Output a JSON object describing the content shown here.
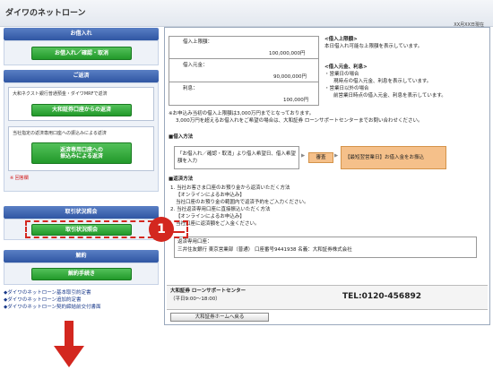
{
  "header": {
    "title": "ダイワのネットローン",
    "date": "XX月XX日現在"
  },
  "left": {
    "borrow": {
      "title": "お借入れ",
      "btn": "お借入れ／確認・取消"
    },
    "repay": {
      "title": "ご返済",
      "box1_title": "大和ネクスト銀行普通預金・ダイワMRFで返済",
      "box1_btn": "大和証券口座からの返済",
      "box2_title": "当社指定の返済専用口座への振込みによる返済",
      "box2_btn_line1": "返済専用口座への",
      "box2_btn_line2": "振込みによる返済",
      "note": "※ 回答欄"
    },
    "history": {
      "title": "取引状況照会",
      "btn": "取引状況照会"
    },
    "cancel": {
      "title": "解約",
      "btn": "解約手続き"
    },
    "links": [
      "◆ダイワのネットローン基本取引約定書",
      "◆ダイワのネットローン追加約定書",
      "◆ダイワのネットローン契約締結前交付書面"
    ]
  },
  "right": {
    "limit": {
      "label": "借入上限額：",
      "value": "100,000,000円"
    },
    "balance": {
      "label": "借入元金：",
      "value": "90,000,000円"
    },
    "interest": {
      "label": "利息：",
      "value": "100,000円"
    },
    "limit_note_title": "<借入上限額>",
    "limit_note": "本日借入れ可能な上限額を表示しています。",
    "principal_note_title": "<借入元金、利息>",
    "principal_note_1": "・営業日の場合",
    "principal_note_2": "現時点の借入元金、利息を表示しています。",
    "principal_note_3": "・営業日以外の場合",
    "principal_note_4": "前営業日時点の借入元金、利息を表示しています。",
    "warn_1": "※お申込み当初の借入上限額は3,000万円までとなっております。",
    "warn_2": "3,000万円を超えるお借入れをご希望の場合は、大和証券 ローンサポートセンターまでお問い合わせください。",
    "method_title": "■借入方法",
    "method_step1": "「お借入れ／確認・取消」より借入希望日、借入希望額を入力",
    "method_step2": "審査",
    "method_step3": "【最短翌営業日】お借入金をお振込",
    "repay_title": "■返済方法",
    "repay_1": "1. 当社お客さま口座のお預り金から返済いただく方法",
    "repay_1a": "【オンラインによるお申込み】",
    "repay_1b": "当社口座のお預り金の範囲内で返済予約をご入力ください。",
    "repay_2": "2. 当社返済専用口座に直接振込いただく方法",
    "repay_2a": "【オンラインによるお申込み】",
    "repay_2b": "当社口座に返済額をご入金ください。",
    "acct_label": "返済専用口座：",
    "acct_value": "三井住友銀行 東京営業部（普通） 口座番号9441938 名義：大和証券株式会社",
    "support_name": "大和証券 ローンサポートセンター",
    "support_hours": "（平日9:00〜18:00）",
    "tel": "TEL:0120-456892",
    "home_btn": "大和証券ホームへ戻る"
  },
  "callout": {
    "number": "1"
  },
  "colors": {
    "accent_green": "#22992a",
    "header_blue": "#2f56a3",
    "callout_red": "#d3271f"
  }
}
